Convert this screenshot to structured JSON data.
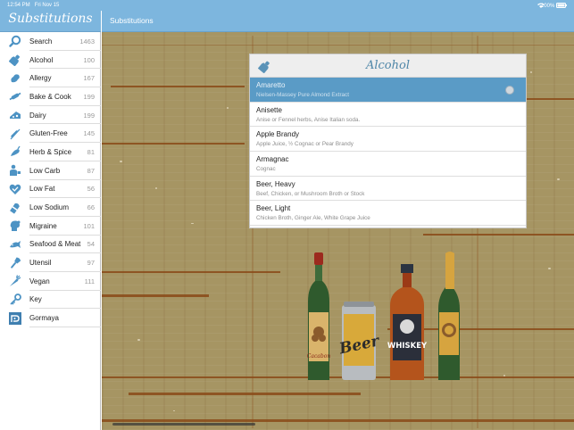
{
  "status": {
    "time": "12:54 PM",
    "date": "Fri Nov 15",
    "battery": "100%"
  },
  "sidebar": {
    "title": "Substitutions",
    "items": [
      {
        "label": "Search",
        "count": "1463",
        "icon": "search-icon"
      },
      {
        "label": "Alcohol",
        "count": "100",
        "icon": "bottle-icon"
      },
      {
        "label": "Allergy",
        "count": "167",
        "icon": "peanut-icon"
      },
      {
        "label": "Bake & Cook",
        "count": "199",
        "icon": "rolling-pin-icon"
      },
      {
        "label": "Dairy",
        "count": "199",
        "icon": "cheese-icon"
      },
      {
        "label": "Gluten-Free",
        "count": "145",
        "icon": "wheat-icon"
      },
      {
        "label": "Herb & Spice",
        "count": "81",
        "icon": "pepper-icon"
      },
      {
        "label": "Low Carb",
        "count": "87",
        "icon": "person-icon"
      },
      {
        "label": "Low Fat",
        "count": "56",
        "icon": "heart-check-icon"
      },
      {
        "label": "Low Sodium",
        "count": "66",
        "icon": "salt-shaker-icon"
      },
      {
        "label": "Migraine",
        "count": "101",
        "icon": "head-icon"
      },
      {
        "label": "Seafood & Meat",
        "count": "54",
        "icon": "fish-icon"
      },
      {
        "label": "Utensil",
        "count": "97",
        "icon": "utensil-icon"
      },
      {
        "label": "Vegan",
        "count": "111",
        "icon": "carrot-icon"
      },
      {
        "label": "Key",
        "count": "",
        "icon": "key-icon"
      },
      {
        "label": "Gormaya",
        "count": "",
        "icon": "gormaya-logo-icon"
      }
    ]
  },
  "main": {
    "title": "Substitutions",
    "card": {
      "title": "Alcohol",
      "rows": [
        {
          "name": "Amaretto",
          "sub": "Nielsen-Massey Pure Almond Extract",
          "selected": true
        },
        {
          "name": "Anisette",
          "sub": "Anise or Fennel herbs, Anise Italian soda.",
          "selected": false
        },
        {
          "name": "Apple Brandy",
          "sub": "Apple Juice, ½ Cognac or Pear Brandy",
          "selected": false
        },
        {
          "name": "Armagnac",
          "sub": "Cognac",
          "selected": false
        },
        {
          "name": "Beer, Heavy",
          "sub": "Beef, Chicken, or Mushroom Broth or Stock",
          "selected": false
        },
        {
          "name": "Beer, Light",
          "sub": "Chicken Broth, Ginger Ale, White Grape Juice",
          "selected": false
        }
      ]
    },
    "bottle_labels": {
      "beer": "Beer",
      "whiskey": "WHISKEY"
    }
  },
  "colors": {
    "accent": "#7db6de",
    "selected_row": "#5a9bc6",
    "wood": "#a69563",
    "title_text": "#4e86a8"
  }
}
